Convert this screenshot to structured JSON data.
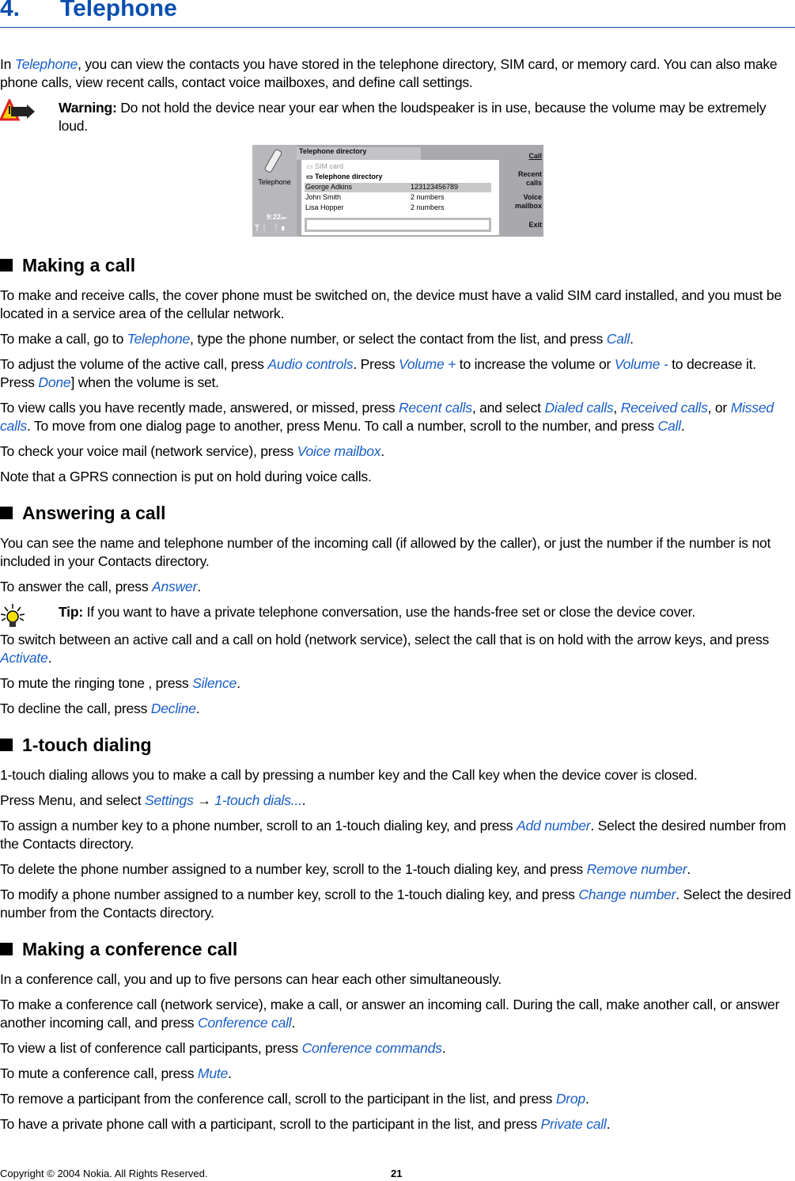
{
  "chapter": {
    "number": "4.",
    "title": "Telephone"
  },
  "blocks": [
    {
      "type": "p",
      "segs": [
        {
          "t": "In "
        },
        {
          "t": "Telephone",
          "link": true
        },
        {
          "t": ", you can view the contacts you have stored in the telephone directory, SIM card, or memory card. You can also make phone calls, view recent calls, contact voice mailboxes, and define call settings."
        }
      ]
    },
    {
      "type": "note",
      "icon": "warning-icon",
      "label": "Warning:",
      "segs": [
        {
          "t": " Do not hold the device near your ear when the loudspeaker is in use, because the volume may be extremely loud."
        }
      ]
    },
    {
      "type": "figure"
    },
    {
      "type": "h2",
      "t": "Making a call"
    },
    {
      "type": "p",
      "segs": [
        {
          "t": "To make and receive calls, the cover phone must be switched on, the device must have a valid SIM card installed, and you must be located in a service area of the cellular network."
        }
      ]
    },
    {
      "type": "p",
      "segs": [
        {
          "t": "To make a call, go to "
        },
        {
          "t": "Telephone",
          "link": true
        },
        {
          "t": ", type the phone number, or select the contact from the list, and press "
        },
        {
          "t": "Call",
          "link": true
        },
        {
          "t": "."
        }
      ]
    },
    {
      "type": "p",
      "segs": [
        {
          "t": "To adjust the volume of the active call, press "
        },
        {
          "t": "Audio controls",
          "link": true
        },
        {
          "t": ". Press "
        },
        {
          "t": "Volume +",
          "link": true
        },
        {
          "t": " to increase the volume or "
        },
        {
          "t": "Volume -",
          "link": true
        },
        {
          "t": " to decrease it. Press "
        },
        {
          "t": "Done",
          "link": true
        },
        {
          "t": "] when the volume is set."
        }
      ]
    },
    {
      "type": "p",
      "segs": [
        {
          "t": "To view calls you have recently made, answered, or missed, press "
        },
        {
          "t": "Recent calls",
          "link": true
        },
        {
          "t": ", and select "
        },
        {
          "t": "Dialed calls",
          "link": true
        },
        {
          "t": ", "
        },
        {
          "t": "Received calls",
          "link": true
        },
        {
          "t": ", or "
        },
        {
          "t": "Missed calls",
          "link": true
        },
        {
          "t": ". To move from one dialog page to another, press Menu. To call a number, scroll to the number, and press "
        },
        {
          "t": "Call",
          "link": true
        },
        {
          "t": "."
        }
      ]
    },
    {
      "type": "p",
      "segs": [
        {
          "t": "To check your voice mail (network service), press "
        },
        {
          "t": "Voice mailbox",
          "link": true
        },
        {
          "t": "."
        }
      ]
    },
    {
      "type": "p",
      "segs": [
        {
          "t": "Note that a GPRS connection is put on hold during voice calls."
        }
      ]
    },
    {
      "type": "h2",
      "t": "Answering a call"
    },
    {
      "type": "p",
      "segs": [
        {
          "t": "You can see the name and telephone number of the incoming call (if allowed by the caller), or just the number if the number is not included in your Contacts directory."
        }
      ]
    },
    {
      "type": "p",
      "segs": [
        {
          "t": "To answer the call, press "
        },
        {
          "t": "Answer",
          "link": true
        },
        {
          "t": "."
        }
      ]
    },
    {
      "type": "note",
      "icon": "tip-lightbulb-icon",
      "label": "Tip:",
      "segs": [
        {
          "t": " If you want to have a private telephone conversation, use the hands-free set or close the device cover."
        }
      ]
    },
    {
      "type": "p",
      "segs": [
        {
          "t": "To switch between an active call and a call on hold (network service), select the call that is on hold with the arrow keys, and press "
        },
        {
          "t": "Activate",
          "link": true
        },
        {
          "t": "."
        }
      ]
    },
    {
      "type": "p",
      "segs": [
        {
          "t": "To mute the ringing tone , press "
        },
        {
          "t": "Silence",
          "link": true
        },
        {
          "t": "."
        }
      ]
    },
    {
      "type": "p",
      "segs": [
        {
          "t": "To decline the call, press "
        },
        {
          "t": "Decline",
          "link": true
        },
        {
          "t": "."
        }
      ]
    },
    {
      "type": "h2",
      "t": "1-touch dialing"
    },
    {
      "type": "p",
      "segs": [
        {
          "t": "1-touch dialing allows you to make a call by pressing a number key and the Call key when the device cover is closed."
        }
      ]
    },
    {
      "type": "p",
      "segs": [
        {
          "t": "Press Menu, and select "
        },
        {
          "t": "Settings",
          "link": true
        },
        {
          "t": "  →  "
        },
        {
          "t": "1-touch dials...",
          "link": true
        },
        {
          "t": "."
        }
      ]
    },
    {
      "type": "p",
      "segs": [
        {
          "t": "To assign a number key to a phone number, scroll to an 1-touch dialing key, and press "
        },
        {
          "t": "Add number",
          "link": true
        },
        {
          "t": ". Select the desired number from the Contacts directory."
        }
      ]
    },
    {
      "type": "p",
      "segs": [
        {
          "t": "To delete the phone number assigned to a number key, scroll to the 1-touch dialing key, and press "
        },
        {
          "t": "Remove number",
          "link": true
        },
        {
          "t": "."
        }
      ]
    },
    {
      "type": "p",
      "segs": [
        {
          "t": "To modify a phone number assigned to a number key, scroll to the 1-touch dialing key, and press "
        },
        {
          "t": "Change number",
          "link": true
        },
        {
          "t": ". Select the desired number from the Contacts directory."
        }
      ]
    },
    {
      "type": "h2",
      "t": "Making a conference call"
    },
    {
      "type": "p",
      "segs": [
        {
          "t": "In a conference call, you and up to five persons can hear each other simultaneously."
        }
      ]
    },
    {
      "type": "p",
      "segs": [
        {
          "t": "To make a conference call (network service), make a call, or answer an incoming call. During the call, make another call, or answer another incoming call, and press "
        },
        {
          "t": "Conference call",
          "link": true
        },
        {
          "t": "."
        }
      ]
    },
    {
      "type": "p",
      "segs": [
        {
          "t": "To view a list of conference call participants, press "
        },
        {
          "t": "Conference commands",
          "link": true
        },
        {
          "t": "."
        }
      ]
    },
    {
      "type": "p",
      "segs": [
        {
          "t": "To mute a conference call, press "
        },
        {
          "t": "Mute",
          "link": true
        },
        {
          "t": "."
        }
      ]
    },
    {
      "type": "p",
      "segs": [
        {
          "t": "To remove a participant from the conference call, scroll to the participant in the list, and press "
        },
        {
          "t": "Drop",
          "link": true
        },
        {
          "t": "."
        }
      ]
    },
    {
      "type": "p",
      "segs": [
        {
          "t": "To have a private phone call with a participant, scroll to the participant in the list, and press "
        },
        {
          "t": "Private call",
          "link": true
        },
        {
          "t": "."
        }
      ]
    }
  ],
  "device_screen": {
    "app_name": "Telephone",
    "time": "9:22",
    "time_suffix": "am",
    "header": "Telephone directory",
    "folders": [
      "SIM card",
      "Telephone directory"
    ],
    "rows": [
      {
        "name": "George Adkins",
        "value": "123123456789",
        "selected": true
      },
      {
        "name": "John Smith",
        "value": "2 numbers"
      },
      {
        "name": "Lisa Hopper",
        "value": "2 numbers"
      }
    ],
    "commands": [
      "Call",
      "Recent calls",
      "Voice mailbox",
      "Exit"
    ]
  },
  "footer": {
    "copyright": "Copyright © 2004 Nokia. All Rights Reserved.",
    "page": "21"
  },
  "colors": {
    "heading": "#0a4fb0",
    "link": "#1a5fc8"
  }
}
